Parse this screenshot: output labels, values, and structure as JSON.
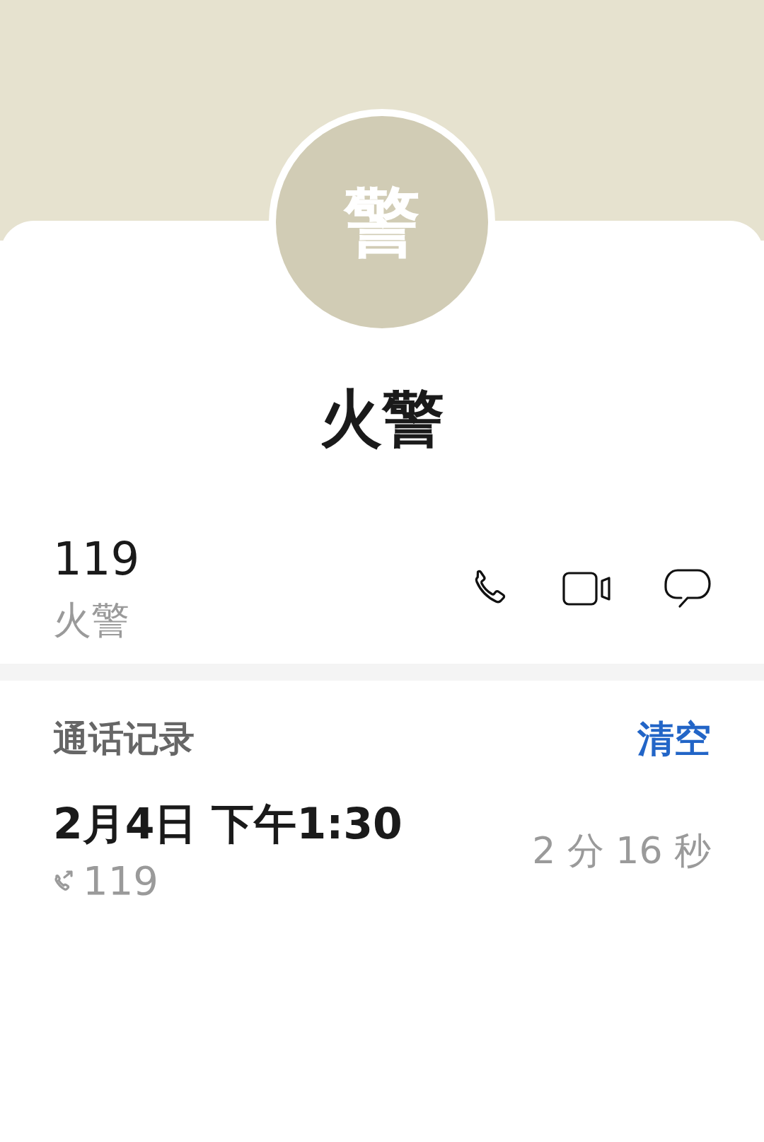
{
  "avatar": {
    "initial": "警"
  },
  "contact": {
    "name": "火警"
  },
  "phones": [
    {
      "number": "119",
      "label": "火警"
    }
  ],
  "call_log": {
    "title": "通话记录",
    "clear_button": "清空",
    "entries": [
      {
        "date": "2月4日 下午1:30",
        "kind": "outgoing",
        "number": "119",
        "duration": "2 分 16 秒"
      }
    ]
  }
}
